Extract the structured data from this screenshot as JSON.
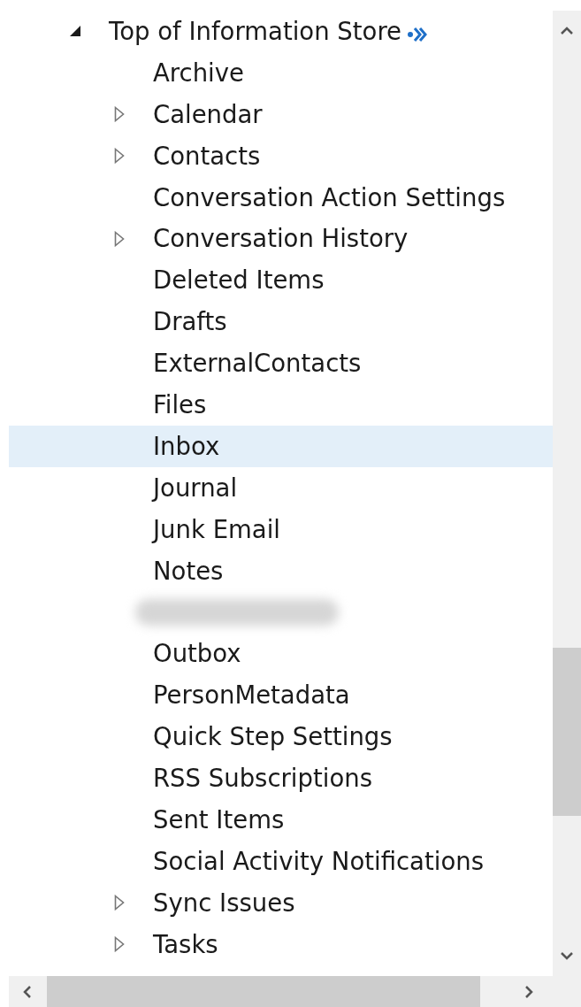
{
  "tree": {
    "label": "Top of Information Store",
    "expanded": true,
    "selected": false,
    "children": [
      {
        "label": "Archive",
        "selected": false
      },
      {
        "label": "Calendar",
        "selected": false,
        "expanded": false
      },
      {
        "label": "Contacts",
        "selected": false,
        "expanded": false
      },
      {
        "label": "Conversation Action Settings",
        "selected": false
      },
      {
        "label": "Conversation History",
        "selected": false,
        "expanded": false
      },
      {
        "label": "Deleted Items",
        "selected": false
      },
      {
        "label": "Drafts",
        "selected": false
      },
      {
        "label": "ExternalContacts",
        "selected": false
      },
      {
        "label": "Files",
        "selected": false
      },
      {
        "label": "Inbox",
        "selected": true
      },
      {
        "label": "Journal",
        "selected": false
      },
      {
        "label": "Junk Email",
        "selected": false
      },
      {
        "label": "Notes",
        "selected": false
      },
      {
        "kind": "redacted",
        "selected": false
      },
      {
        "label": "Outbox",
        "selected": false
      },
      {
        "label": "PersonMetadata",
        "selected": false
      },
      {
        "label": "Quick Step Settings",
        "selected": false
      },
      {
        "label": "RSS Subscriptions",
        "selected": false
      },
      {
        "label": "Sent Items",
        "selected": false
      },
      {
        "label": "Social Activity Notifications",
        "selected": false
      },
      {
        "label": "Sync Issues",
        "selected": false,
        "expanded": false
      },
      {
        "label": "Tasks",
        "selected": false,
        "expanded": false
      }
    ]
  }
}
